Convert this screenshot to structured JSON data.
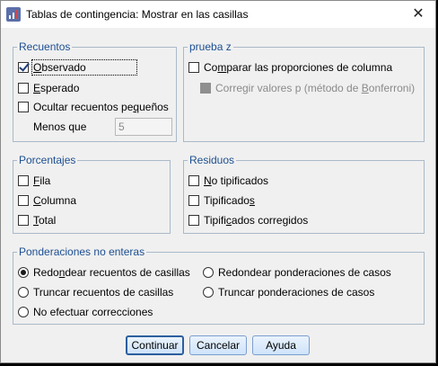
{
  "window": {
    "title": "Tablas de contingencia: Mostrar en las casillas",
    "close_label": "✕"
  },
  "recuentos": {
    "legend": "Recuentos",
    "observado": {
      "pre": "",
      "u": "O",
      "post": "bservado",
      "checked": true
    },
    "esperado": {
      "pre": "",
      "u": "E",
      "post": "sperado",
      "checked": false
    },
    "ocultar": {
      "pre": "Ocultar recuentos pe",
      "u": "q",
      "post": "ueños",
      "checked": false
    },
    "menos_que_label": "Menos que",
    "menos_que_value": "5"
  },
  "prueba_z": {
    "legend": "prueba z",
    "comparar": {
      "pre": "Co",
      "u": "m",
      "post": "parar las proporciones de columna",
      "checked": false
    },
    "corregir": {
      "pre": "Corregir valores p (método de ",
      "u": "B",
      "post": "onferroni)",
      "checked": false,
      "disabled": true
    }
  },
  "porcentajes": {
    "legend": "Porcentajes",
    "fila": {
      "pre": "",
      "u": "F",
      "post": "ila",
      "checked": false
    },
    "columna": {
      "pre": "",
      "u": "C",
      "post": "olumna",
      "checked": false
    },
    "total": {
      "pre": "",
      "u": "T",
      "post": "otal",
      "checked": false
    }
  },
  "residuos": {
    "legend": "Residuos",
    "no_tipificados": {
      "pre": "",
      "u": "N",
      "post": "o tipificados",
      "checked": false
    },
    "tipificados": {
      "pre": "Tipificado",
      "u": "s",
      "post": "",
      "checked": false
    },
    "tipificados_corregidos": {
      "pre": "Tipifi",
      "u": "c",
      "post": "ados corregidos",
      "checked": false
    }
  },
  "ponderaciones": {
    "legend": "Ponderaciones no enteras",
    "redondear_recuentos": {
      "pre": "Redo",
      "u": "n",
      "post": "dear recuentos de casillas",
      "selected": true
    },
    "redondear_ponderaciones": {
      "pre": "Redondear ponderaciones de casos",
      "u": "",
      "post": "",
      "selected": false
    },
    "truncar_recuentos": {
      "pre": "Truncar recuentos de casillas",
      "u": "",
      "post": "",
      "selected": false
    },
    "truncar_ponderaciones": {
      "pre": "Truncar ponderaciones de casos",
      "u": "",
      "post": "",
      "selected": false
    },
    "no_efectuar": {
      "pre": "No efectuar correcciones",
      "u": "",
      "post": "",
      "selected": false
    }
  },
  "buttons": {
    "continuar": "Continuar",
    "cancelar": "Cancelar",
    "ayuda": "Ayuda"
  }
}
